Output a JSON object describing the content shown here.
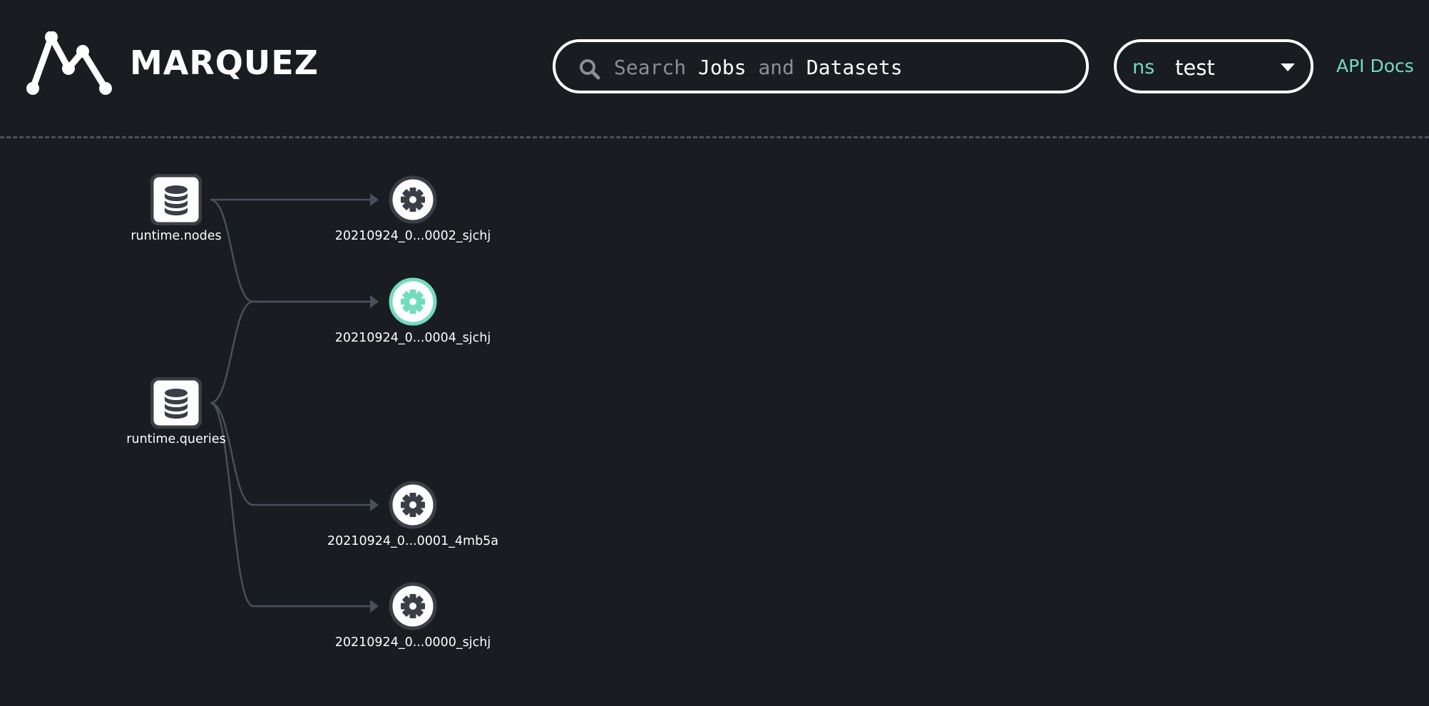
{
  "header": {
    "logo_text": "MARQUEZ",
    "search": {
      "prefix": "Search",
      "jobs": "Jobs",
      "and": "and",
      "datasets": "Datasets"
    },
    "namespace": {
      "label": "ns",
      "value": "test"
    },
    "api_docs_label": "API Docs"
  },
  "colors": {
    "background": "#191d22",
    "accent": "#71ddbf",
    "edge": "#4a5059",
    "node_fill": "#ffffff",
    "icon_dark": "#3a3f47"
  },
  "graph": {
    "datasets": [
      {
        "label": "runtime.nodes",
        "icon": "database-icon"
      },
      {
        "label": "runtime.queries",
        "icon": "database-icon"
      }
    ],
    "jobs": [
      {
        "label": "20210924_0...0002_sjchj",
        "icon": "gear-icon",
        "selected": false
      },
      {
        "label": "20210924_0...0004_sjchj",
        "icon": "gear-icon",
        "selected": true
      },
      {
        "label": "20210924_0...0001_4mb5a",
        "icon": "gear-icon",
        "selected": false
      },
      {
        "label": "20210924_0...0000_sjchj",
        "icon": "gear-icon",
        "selected": false
      }
    ],
    "edges": [
      {
        "from": "runtime.nodes",
        "to": "20210924_0...0002_sjchj"
      },
      {
        "from": "runtime.nodes",
        "to": "20210924_0...0004_sjchj"
      },
      {
        "from": "runtime.queries",
        "to": "20210924_0...0004_sjchj"
      },
      {
        "from": "runtime.queries",
        "to": "20210924_0...0001_4mb5a"
      },
      {
        "from": "runtime.queries",
        "to": "20210924_0...0000_sjchj"
      }
    ]
  }
}
